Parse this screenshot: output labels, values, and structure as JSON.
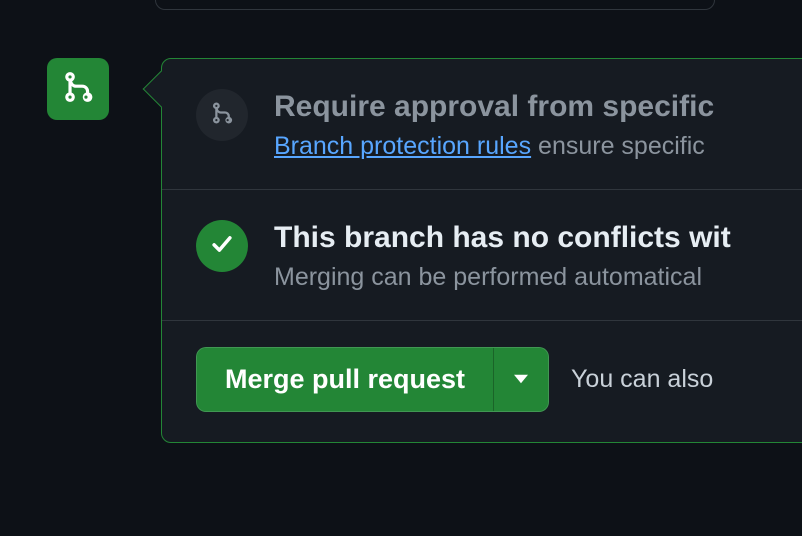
{
  "approval": {
    "title": "Require approval from specific ",
    "link_text": "Branch protection rules",
    "sub_rest": " ensure specific"
  },
  "conflict": {
    "title": "This branch has no conflicts wit",
    "sub": "Merging can be performed automatical"
  },
  "footer": {
    "merge_label": "Merge pull request",
    "aside": "You can also"
  }
}
